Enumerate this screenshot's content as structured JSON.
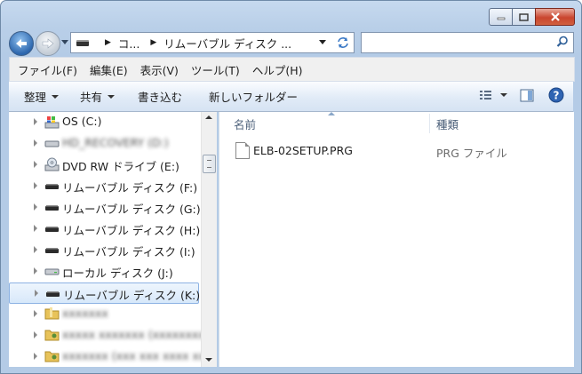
{
  "address": {
    "segments": [
      "コ...",
      "リムーバブル ディスク ..."
    ]
  },
  "search": {
    "placeholder": ""
  },
  "menu": [
    "ファイル(F)",
    "編集(E)",
    "表示(V)",
    "ツール(T)",
    "ヘルプ(H)"
  ],
  "commands": {
    "organize": "整理",
    "share": "共有",
    "burn": "書き込む",
    "new_folder": "新しいフォルダー"
  },
  "tree": [
    {
      "label": "OS (C:)",
      "icon": "os-drive-icon",
      "blurred": false
    },
    {
      "label": "HD_RECOVERY (D:)",
      "icon": "hard-drive-icon",
      "blurred": true
    },
    {
      "label": "DVD RW ドライブ (E:)",
      "icon": "dvd-drive-icon",
      "blurred": false
    },
    {
      "label": "リムーバブル ディスク (F:)",
      "icon": "removable-disk-icon",
      "blurred": false
    },
    {
      "label": "リムーバブル ディスク (G:)",
      "icon": "removable-disk-icon",
      "blurred": false
    },
    {
      "label": "リムーバブル ディスク (H:)",
      "icon": "removable-disk-icon",
      "blurred": false
    },
    {
      "label": "リムーバブル ディスク (I:)",
      "icon": "removable-disk-icon",
      "blurred": false
    },
    {
      "label": "ローカル ディスク (J:)",
      "icon": "local-disk-icon",
      "blurred": false
    },
    {
      "label": "リムーバブル ディスク (K:)",
      "icon": "removable-disk-icon",
      "blurred": false,
      "selected": true
    },
    {
      "label": "xxxxxxx",
      "icon": "folder-icon",
      "blurred": true
    },
    {
      "label": "xxxxx xxxxxxx (xxxxxxxx",
      "icon": "user-folder-icon",
      "blurred": true
    },
    {
      "label": "xxxxxxx (xxx xxx xxxx xx",
      "icon": "user-folder-icon",
      "blurred": true
    }
  ],
  "columns": {
    "name": "名前",
    "type": "種類"
  },
  "files": [
    {
      "name": "ELB-02SETUP.PRG",
      "type": "PRG ファイル"
    }
  ],
  "colors": {
    "accent": "#3b79c6",
    "selection": "#d7e8fa",
    "close": "#c9452e"
  }
}
